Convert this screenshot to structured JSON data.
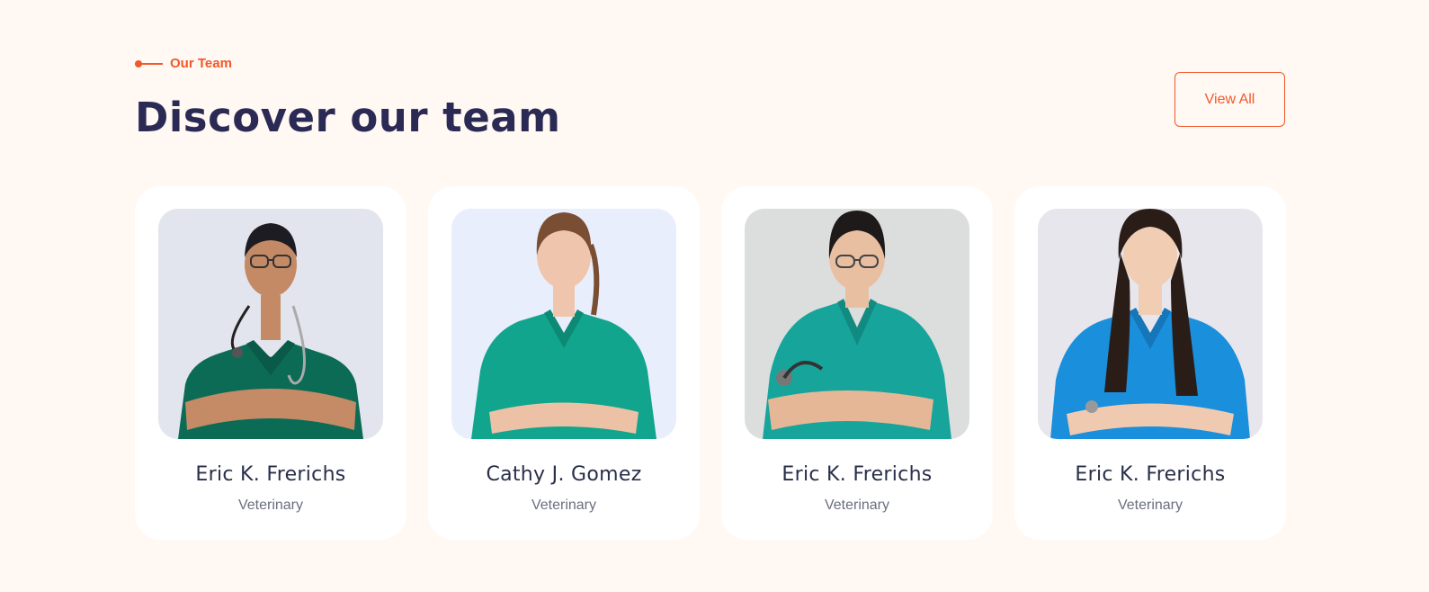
{
  "header": {
    "eyebrow": "Our Team",
    "title": "Discover our team",
    "view_all_label": "View All"
  },
  "colors": {
    "accent": "#f2582a",
    "title": "#2a2a55",
    "background": "#fff8f3"
  },
  "team": [
    {
      "name": "Eric K. Frerichs",
      "role": "Veterinary",
      "photo": "male doctor in green scrubs with stethoscope"
    },
    {
      "name": "Cathy J. Gomez",
      "role": "Veterinary",
      "photo": "female doctor in teal scrubs smiling"
    },
    {
      "name": "Eric K. Frerichs",
      "role": "Veterinary",
      "photo": "female doctor with glasses holding stethoscope"
    },
    {
      "name": "Eric K. Frerichs",
      "role": "Veterinary",
      "photo": "female doctor in blue scrubs with stethoscope"
    }
  ]
}
